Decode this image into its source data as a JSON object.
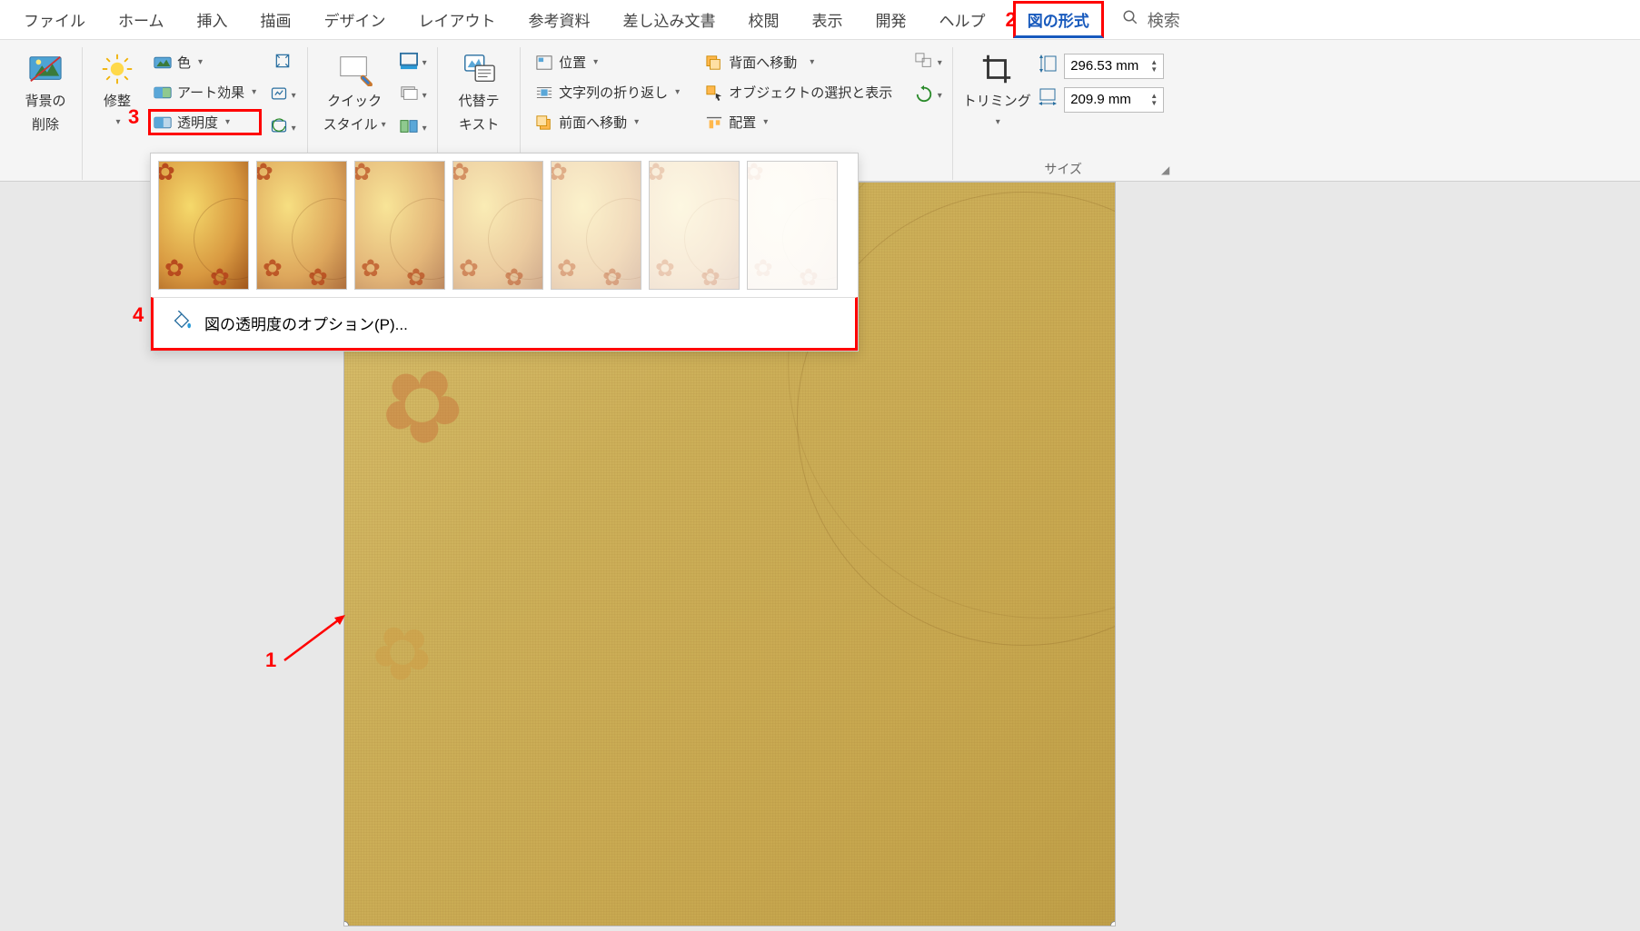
{
  "tabs": {
    "file": "ファイル",
    "home": "ホーム",
    "insert": "挿入",
    "draw": "描画",
    "design": "デザイン",
    "layout": "レイアウト",
    "references": "参考資料",
    "mailings": "差し込み文書",
    "review": "校閲",
    "view": "表示",
    "developer": "開発",
    "help": "ヘルプ",
    "picture_format": "図の形式",
    "search": "検索"
  },
  "ribbon": {
    "remove_bg_l1": "背景の",
    "remove_bg_l2": "削除",
    "corrections": "修整",
    "color": "色",
    "artistic": "アート効果",
    "transparency": "透明度",
    "quick_style_l1": "クイック",
    "quick_style_l2": "スタイル",
    "alt_text_l1": "代替テ",
    "alt_text_l2": "キスト",
    "position": "位置",
    "wrap_text": "文字列の折り返し",
    "bring_forward": "前面へ移動",
    "send_backward": "背面へ移動",
    "selection_pane": "オブジェクトの選択と表示",
    "align": "配置",
    "crop": "トリミング",
    "height_value": "296.53 mm",
    "width_value": "209.9 mm",
    "size_group_label": "サイズ"
  },
  "gallery": {
    "options_label": "図の透明度のオプション(P)...",
    "transparency_levels": [
      0,
      15,
      30,
      50,
      65,
      80,
      95
    ]
  },
  "annotations": {
    "n1": "1",
    "n2": "2",
    "n3": "3",
    "n4": "4"
  }
}
